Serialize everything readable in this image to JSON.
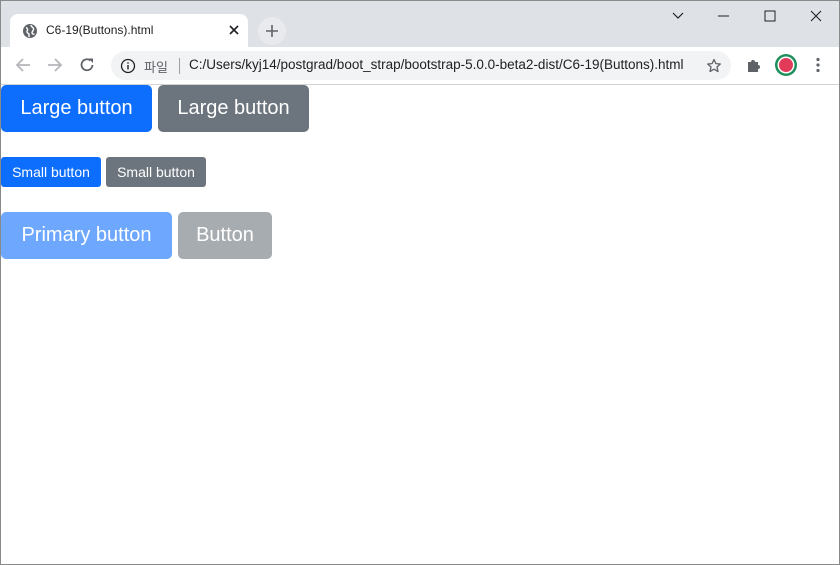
{
  "browser": {
    "tab": {
      "title": "C6-19(Buttons).html",
      "icon": "globe-icon"
    },
    "new_tab_icon": "plus-icon",
    "window_controls": [
      "chevron-down-icon",
      "minimize-icon",
      "maximize-icon",
      "close-icon"
    ],
    "toolbar": {
      "back_icon": "back-arrow-icon",
      "forward_icon": "forward-arrow-icon",
      "reload_icon": "reload-icon",
      "address": {
        "info_icon": "info-icon",
        "scheme_label": "파일",
        "url": "C:/Users/kyj14/postgrad/boot_strap/bootstrap-5.0.0-beta2-dist/C6-19(Buttons).html",
        "star_icon": "star-icon"
      },
      "extensions_icon": "puzzle-icon",
      "profile_icon": "profile-avatar-icon",
      "menu_icon": "more-vert-icon"
    }
  },
  "page": {
    "large_buttons": [
      "Large button",
      "Large button"
    ],
    "small_buttons": [
      "Small button",
      "Small button"
    ],
    "disabled_buttons": [
      "Primary button",
      "Button"
    ]
  },
  "colors": {
    "primary": "#0d6efd",
    "secondary": "#6c757d",
    "primary_disabled": "#6ea8fe",
    "secondary_disabled": "#a7acb1"
  }
}
